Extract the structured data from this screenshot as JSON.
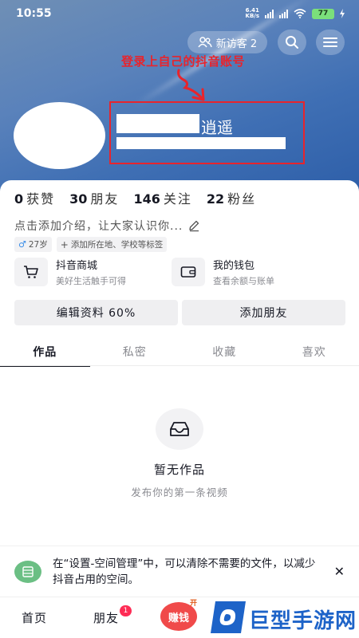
{
  "status_bar": {
    "time": "10:55",
    "net_speed_value": "6.41",
    "net_speed_unit": "KB/s",
    "battery": "77"
  },
  "header": {
    "visitor_label": "新访客 2",
    "annotation_text": "登录上自己的抖音账号",
    "nickname": "逍遥"
  },
  "stats": [
    {
      "value": "0",
      "label": "获赞"
    },
    {
      "value": "30",
      "label": "朋友"
    },
    {
      "value": "146",
      "label": "关注"
    },
    {
      "value": "22",
      "label": "粉丝"
    }
  ],
  "bio": {
    "placeholder": "点击添加介绍，让大家认识你..."
  },
  "tags": {
    "age": "27岁",
    "add": "添加所在地、学校等标签"
  },
  "shortcuts": [
    {
      "title": "抖音商城",
      "subtitle": "美好生活触手可得",
      "icon": "cart-icon"
    },
    {
      "title": "我的钱包",
      "subtitle": "查看余额与账单",
      "icon": "wallet-icon"
    }
  ],
  "buttons": {
    "edit_profile": "编辑资料 60%",
    "add_friend": "添加朋友"
  },
  "tabs": [
    "作品",
    "私密",
    "收藏",
    "喜欢"
  ],
  "empty_state": {
    "title": "暂无作品",
    "subtitle": "发布你的第一条视频"
  },
  "notice": {
    "text": "在“设置-空间管理”中，可以清除不需要的文件，以减少抖音占用的空间。"
  },
  "bottom_nav": {
    "home": "首页",
    "friends": "朋友",
    "friends_badge": "1",
    "earn": "赚钱",
    "earn_tag": "开"
  },
  "watermark": {
    "text": "巨型手游网"
  },
  "colors": {
    "annotation_red": "#e8242c",
    "badge_pink": "#fe2c55",
    "notice_green": "#6bbf84",
    "watermark_blue": "#1d63c8"
  }
}
